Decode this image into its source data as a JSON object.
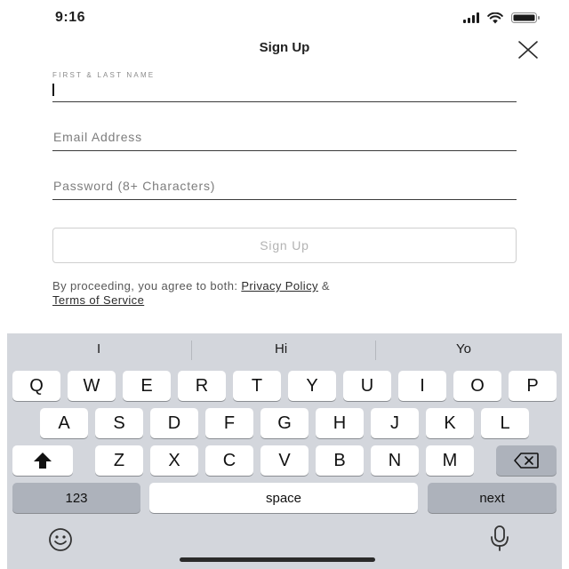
{
  "status": {
    "time": "9:16"
  },
  "header": {
    "title": "Sign Up"
  },
  "form": {
    "name_label": "FIRST & LAST NAME",
    "name_value": "",
    "email_placeholder": "Email Address",
    "password_placeholder": "Password (8+ Characters)",
    "submit_label": "Sign Up"
  },
  "legal": {
    "prefix": "By proceeding, you agree to both: ",
    "privacy_link": "Privacy Policy",
    "joiner": " &",
    "terms_link": "Terms of Service"
  },
  "keyboard": {
    "suggestions": [
      "I",
      "Hi",
      "Yo"
    ],
    "row1": [
      "Q",
      "W",
      "E",
      "R",
      "T",
      "Y",
      "U",
      "I",
      "O",
      "P"
    ],
    "row2": [
      "A",
      "S",
      "D",
      "F",
      "G",
      "H",
      "J",
      "K",
      "L"
    ],
    "row3": [
      "Z",
      "X",
      "C",
      "V",
      "B",
      "N",
      "M"
    ],
    "numbers_key": "123",
    "space_key": "space",
    "return_key": "next",
    "shift_icon": "shift-icon",
    "backspace_icon": "backspace-icon",
    "emoji_icon": "emoji-icon",
    "dictation_icon": "microphone-icon"
  }
}
